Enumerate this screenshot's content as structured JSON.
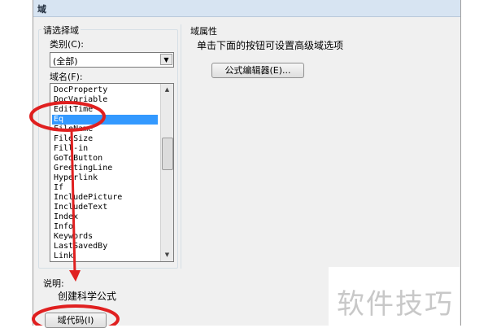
{
  "dialog": {
    "title": "域",
    "left_panel": {
      "group_label": "请选择域",
      "category_label": "类别(C):",
      "category_value": "(全部)",
      "field_names_label": "域名(F):",
      "field_names": [
        "DocProperty",
        "DocVariable",
        "EditTime",
        "Eq",
        "FileName",
        "FileSize",
        "Fill-in",
        "GoToButton",
        "GreetingLine",
        "Hyperlink",
        "If",
        "IncludePicture",
        "IncludeText",
        "Index",
        "Info",
        "Keywords",
        "LastSavedBy",
        "Link"
      ],
      "selected_field": "Eq"
    },
    "right_panel": {
      "group_label": "域属性",
      "hint": "单击下面的按钮可设置高级域选项",
      "formula_editor_button": "公式编辑器(E)..."
    },
    "description_label": "说明:",
    "description_text": "创建科学公式",
    "field_codes_button": "域代码(I)"
  },
  "watermark": "软件技巧",
  "colors": {
    "annotation": "#e02020",
    "selection": "#3399ff"
  }
}
